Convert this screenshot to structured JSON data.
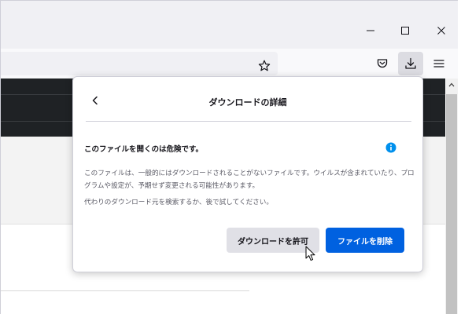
{
  "window": {
    "controls": [
      {
        "name": "minimize",
        "glyph": "—"
      },
      {
        "name": "maximize",
        "glyph": "□"
      },
      {
        "name": "close",
        "glyph": "✕"
      }
    ]
  },
  "toolbar": {
    "icons": [
      "bookmark-star-icon",
      "pocket-icon",
      "download-icon",
      "hamburger-menu-icon"
    ],
    "active_button": "download",
    "colors": {
      "active_bg": "#dcdce2"
    }
  },
  "panel": {
    "title": "ダウンロードの詳細",
    "warning_title": "このファイルを開くのは危険です。",
    "description": "このファイルは、一般的にはダウンロードされることがないファイルです。ウイルスが含まれていたり、プログラムや設定が、予期せず変更される可能性があります。",
    "alternative": "代わりのダウンロード元を検索するか、後で試してください。",
    "allow_button": "ダウンロードを許可",
    "delete_button": "ファイルを削除",
    "colors": {
      "primary": "#0061e0",
      "info": "#0090ed"
    }
  }
}
